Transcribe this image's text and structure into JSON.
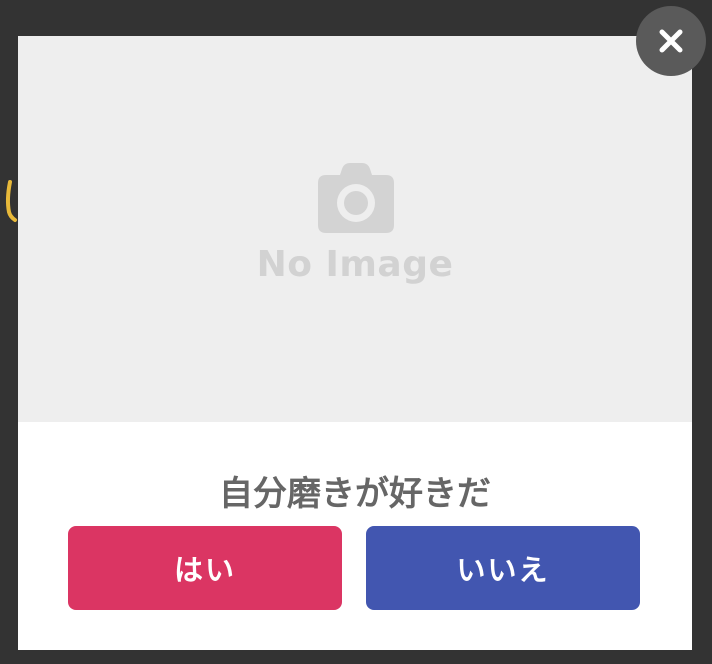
{
  "modal": {
    "image_placeholder": {
      "icon": "camera-icon",
      "text": "No Image"
    },
    "question": "自分磨きが好きだ",
    "yes_label": "はい",
    "no_label": "いいえ",
    "close_icon": "close-icon"
  },
  "colors": {
    "backdrop": "#333333",
    "image_bg": "#eeeeee",
    "placeholder": "#d2d2d2",
    "question_text": "#666666",
    "yes_button": "#db3563",
    "no_button": "#4256b0",
    "close_button": "#5a5a5a",
    "background_accent": "#f0c040"
  }
}
